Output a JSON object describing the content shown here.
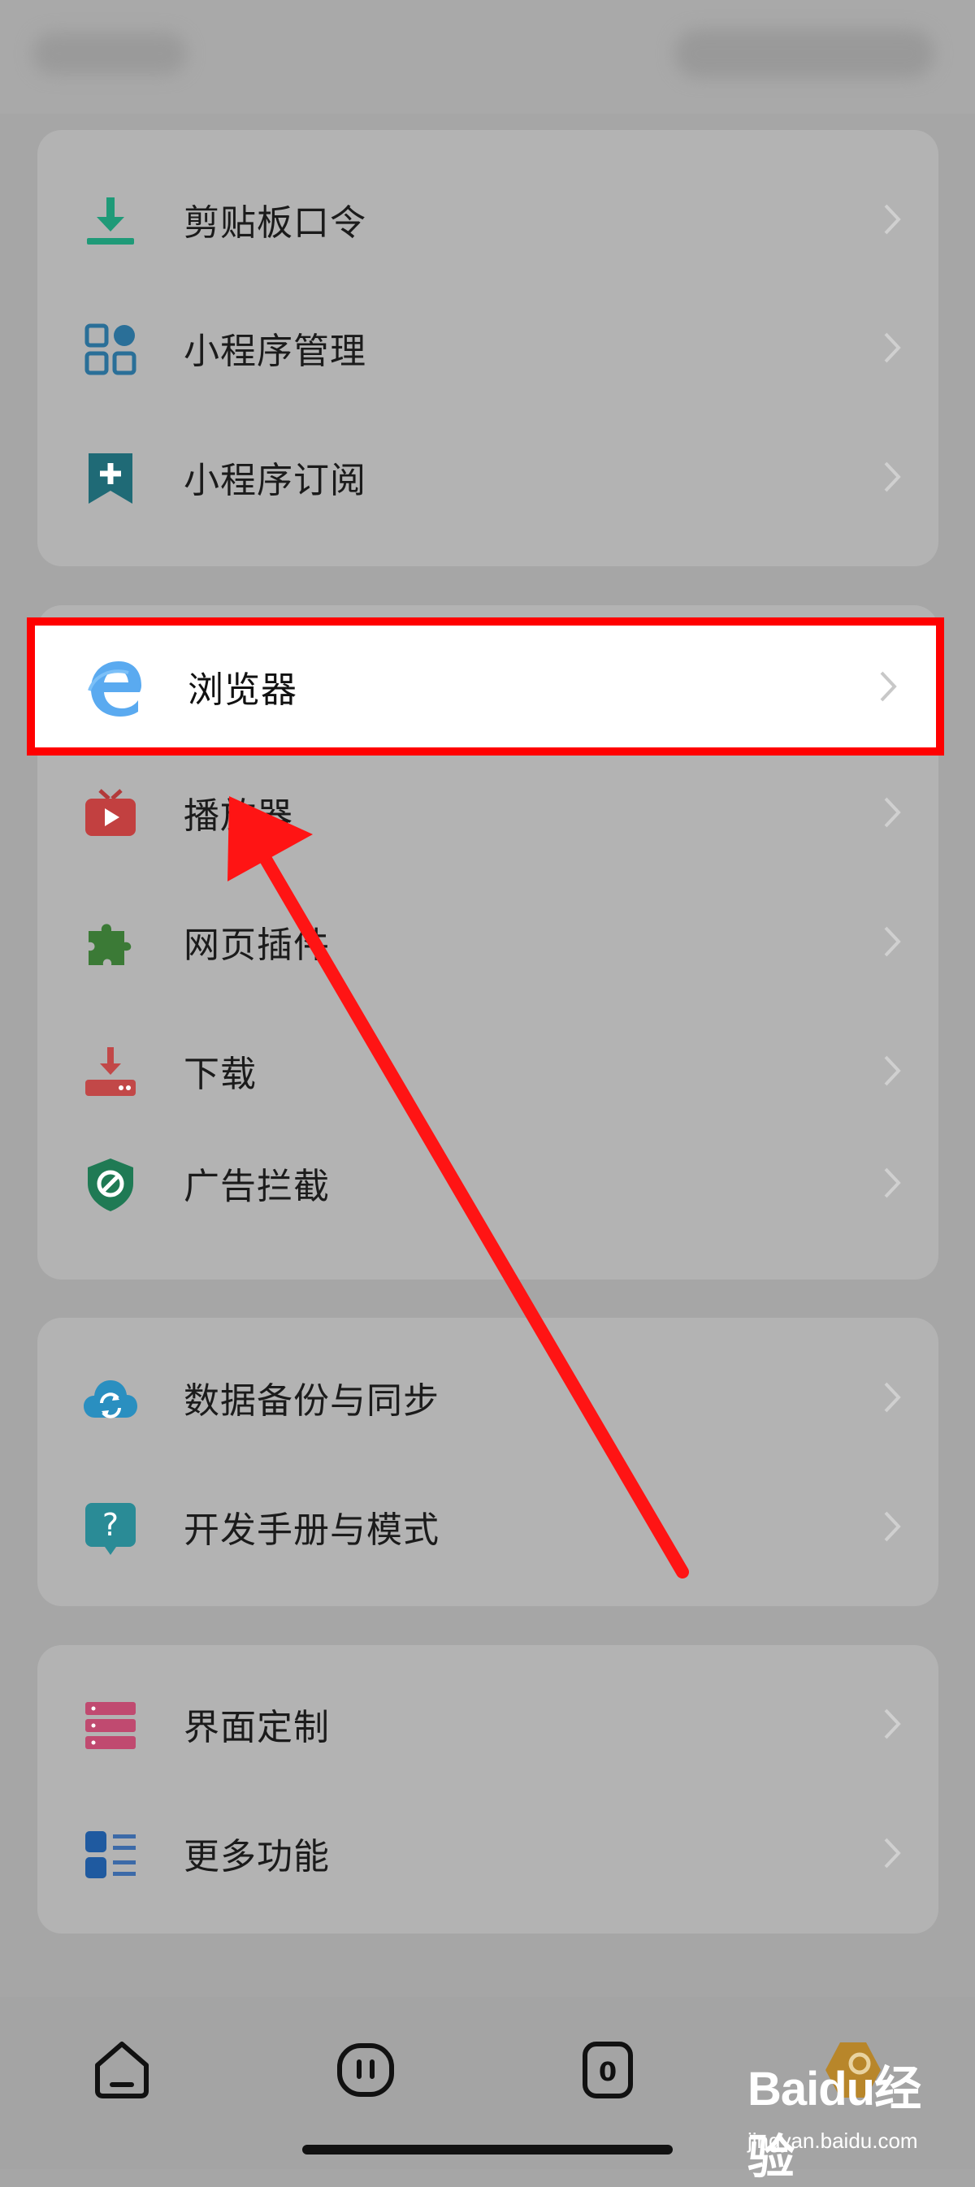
{
  "status_bar": {
    "left_text": "",
    "right_text": ""
  },
  "sections": [
    {
      "items": [
        {
          "label": "剪贴板口令",
          "icon": "clipboard-download-icon"
        },
        {
          "label": "小程序管理",
          "icon": "app-grid-icon"
        },
        {
          "label": "小程序订阅",
          "icon": "bookmark-plus-icon"
        }
      ]
    },
    {
      "items": [
        {
          "label": "浏览器",
          "icon": "browser-e-icon",
          "highlighted": true
        },
        {
          "label": "播放器",
          "icon": "tv-play-icon"
        },
        {
          "label": "网页插件",
          "icon": "puzzle-icon"
        },
        {
          "label": "下载",
          "icon": "download-tray-icon"
        },
        {
          "label": "广告拦截",
          "icon": "shield-block-icon"
        }
      ]
    },
    {
      "items": [
        {
          "label": "数据备份与同步",
          "icon": "cloud-sync-icon"
        },
        {
          "label": "开发手册与模式",
          "icon": "help-bubble-icon"
        }
      ]
    },
    {
      "items": [
        {
          "label": "界面定制",
          "icon": "layout-layers-icon"
        },
        {
          "label": "更多功能",
          "icon": "more-list-icon"
        }
      ]
    }
  ],
  "bottom_nav": [
    {
      "name": "home",
      "icon": "home-icon"
    },
    {
      "name": "ai",
      "icon": "face-icon"
    },
    {
      "name": "tabs",
      "icon": "tab-count-icon",
      "count": "0"
    },
    {
      "name": "me",
      "icon": "profile-badge-icon"
    }
  ],
  "watermark": {
    "logo": "Baidu经验",
    "url": "jingyan.baidu.com"
  },
  "colors": {
    "highlight_border": "#ff0000",
    "arrow": "#ff1414",
    "overlay_bg": "#a6a6a6"
  }
}
